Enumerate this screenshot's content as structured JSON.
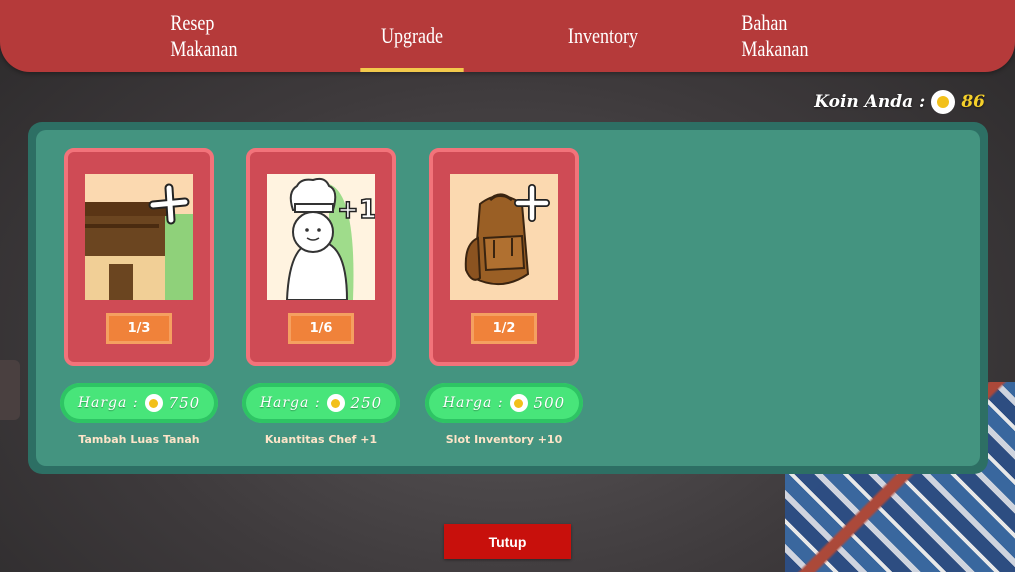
{
  "tabs": [
    {
      "label": "Resep Makanan",
      "active": false
    },
    {
      "label": "Upgrade",
      "active": true
    },
    {
      "label": "Inventory",
      "active": false
    },
    {
      "label": "Bahan Makanan",
      "active": false
    }
  ],
  "coins": {
    "label": "Koin Anda :",
    "value": "86",
    "icon": "coin-icon"
  },
  "upgrades": [
    {
      "level": "1/3",
      "price_label": "Harga :",
      "price": "750",
      "title": "Tambah Luas Tanah",
      "icon": "land-plus-icon"
    },
    {
      "level": "1/6",
      "price_label": "Harga :",
      "price": "250",
      "title": "Kuantitas Chef +1",
      "icon": "chef-plus-one-icon"
    },
    {
      "level": "1/2",
      "price_label": "Harga :",
      "price": "500",
      "title": "Slot Inventory +10",
      "icon": "backpack-plus-icon"
    }
  ],
  "close_button": {
    "label": "Tutup"
  },
  "colors": {
    "topbar": "#b53a3a",
    "active_tab_underline": "#f2c94c",
    "panel": "#449480",
    "card": "#cf4b55",
    "price_pill": "#48e57a",
    "close_button": "#c8100c"
  }
}
